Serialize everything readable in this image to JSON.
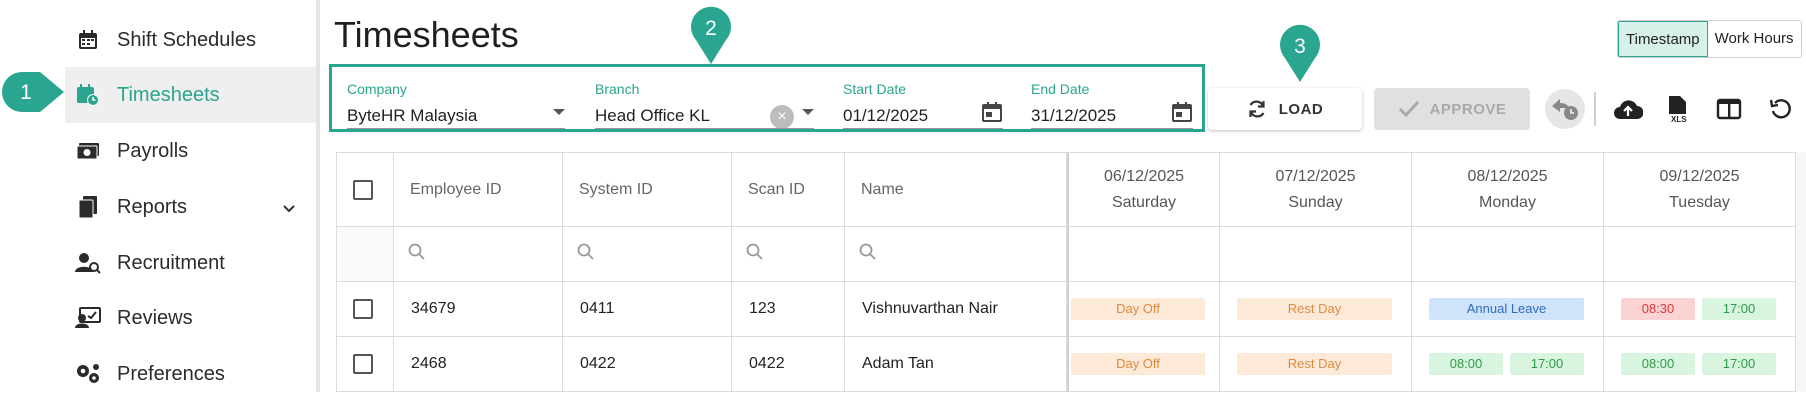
{
  "sidebar": {
    "items": [
      {
        "label": "Shift Schedules",
        "icon": "calendar-icon"
      },
      {
        "label": "Timesheets",
        "icon": "calendar-clock-icon",
        "active": true
      },
      {
        "label": "Payrolls",
        "icon": "money-icon"
      },
      {
        "label": "Reports",
        "icon": "documents-icon",
        "expandable": true
      },
      {
        "label": "Recruitment",
        "icon": "person-search-icon"
      },
      {
        "label": "Reviews",
        "icon": "review-icon"
      },
      {
        "label": "Preferences",
        "icon": "gears-icon"
      }
    ]
  },
  "callouts": [
    "1",
    "2",
    "3"
  ],
  "page": {
    "title": "Timesheets"
  },
  "filters": {
    "company": {
      "label": "Company",
      "value": "ByteHR Malaysia"
    },
    "branch": {
      "label": "Branch",
      "value": "Head Office KL"
    },
    "start_date": {
      "label": "Start Date",
      "value": "01/12/2025"
    },
    "end_date": {
      "label": "End Date",
      "value": "31/12/2025"
    }
  },
  "toolbar": {
    "load_label": "LOAD",
    "approve_label": "APPROVE"
  },
  "view_toggle": {
    "options": [
      "Timestamp",
      "Work Hours"
    ],
    "selected": "Timestamp"
  },
  "table": {
    "columns": [
      "Employee ID",
      "System ID",
      "Scan ID",
      "Name"
    ],
    "days": [
      {
        "date": "06/12/2025",
        "weekday": "Saturday"
      },
      {
        "date": "07/12/2025",
        "weekday": "Sunday"
      },
      {
        "date": "08/12/2025",
        "weekday": "Monday"
      },
      {
        "date": "09/12/2025",
        "weekday": "Tuesday"
      }
    ],
    "rows": [
      {
        "employee_id": "34679",
        "system_id": "0411",
        "scan_id": "123",
        "name": "Vishnuvarthan Nair",
        "d1": "Day Off",
        "d2": "Rest Day",
        "d3": "Annual Leave",
        "d4_in": "08:30",
        "d4_out": "17:00"
      },
      {
        "employee_id": "2468",
        "system_id": "0422",
        "scan_id": "0422",
        "name": "Adam Tan",
        "d1": "Day Off",
        "d2": "Rest Day",
        "d3_in": "08:00",
        "d3_out": "17:00",
        "d4_in": "08:00",
        "d4_out": "17:00"
      }
    ]
  },
  "colors": {
    "accent": "#2aa58f",
    "day_off": "#fde9d7",
    "leave": "#cfe3fb",
    "late": "#fbd3d3",
    "on_time": "#d9f5df"
  }
}
